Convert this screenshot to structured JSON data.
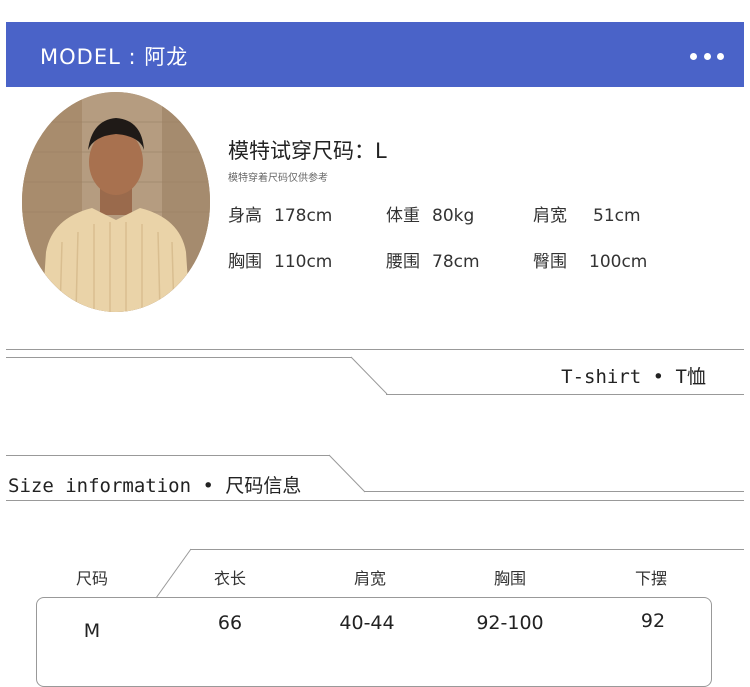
{
  "header": {
    "title": "MODEL : 阿龙",
    "more_icon": "more-dots-icon"
  },
  "model": {
    "heading": "模特试穿尺码：L",
    "note": "模特穿着尺码仅供参考",
    "stats_row1": [
      {
        "label": "身高",
        "value": "178cm"
      },
      {
        "label": "体重",
        "value": "80kg"
      },
      {
        "label": "肩宽",
        "value": "51cm"
      }
    ],
    "stats_row2": [
      {
        "label": "胸围",
        "value": "110cm"
      },
      {
        "label": "腰围",
        "value": "78cm"
      },
      {
        "label": "臀围",
        "value": "100cm"
      }
    ]
  },
  "product_band": {
    "label_en": "T-shirt • T",
    "label_zh": "恤"
  },
  "size_band": {
    "label_en": "Size information • ",
    "label_zh": "尺码信息"
  },
  "size_table": {
    "headers": [
      "尺码",
      "衣长",
      "肩宽",
      "胸围",
      "下摆"
    ],
    "rows": [
      [
        "M",
        "66",
        "40-44",
        "92-100",
        "92"
      ]
    ]
  },
  "colors": {
    "header_bg": "#4a63c8",
    "line": "#999999"
  }
}
